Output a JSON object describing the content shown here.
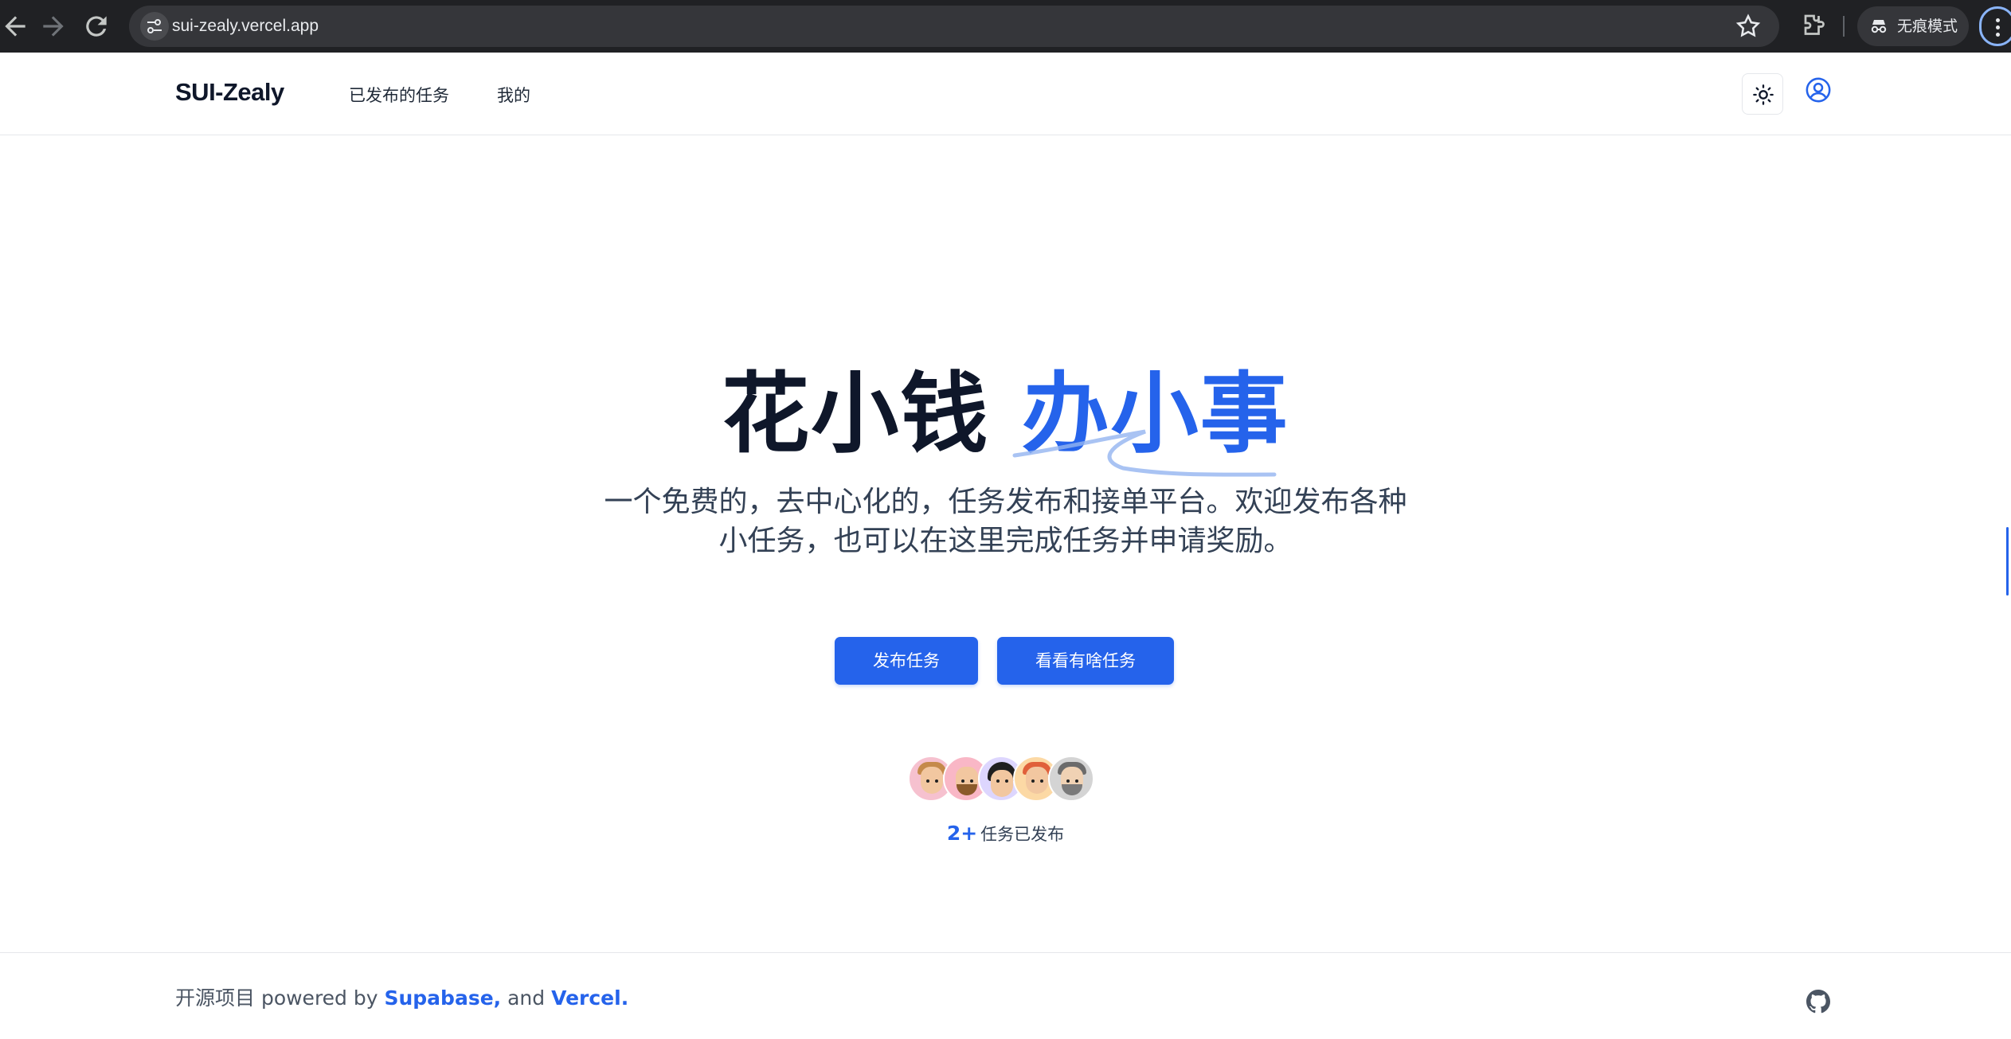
{
  "browser": {
    "url": "sui-zealy.vercel.app",
    "incognito_label": "无痕模式"
  },
  "header": {
    "logo": "SUI-Zealy",
    "nav": [
      "已发布的任务",
      "我的"
    ]
  },
  "hero": {
    "title_dark": "花小钱",
    "title_blue": "办小事",
    "subtitle_line1": "一个免费的，去中心化的，任务发布和接单平台。欢迎发布各种",
    "subtitle_line2": "小任务，也可以在这里完成任务并申请奖励。",
    "primary_button": "发布任务",
    "secondary_button": "看看有啥任务",
    "stat_number": "2+",
    "stat_label": "任务已发布"
  },
  "footer": {
    "prefix": "开源项目 powered by ",
    "link1": "Supabase,",
    "middle": " and ",
    "link2": "Vercel."
  },
  "colors": {
    "accent": "#2563eb",
    "text_dark": "#0f172a",
    "chrome_bg": "#202124"
  },
  "icons": [
    "back-arrow-icon",
    "forward-arrow-icon",
    "reload-icon",
    "site-settings-icon",
    "bookmark-star-icon",
    "extensions-icon",
    "incognito-icon",
    "more-menu-icon",
    "sun-icon",
    "user-circle-icon",
    "github-icon"
  ]
}
